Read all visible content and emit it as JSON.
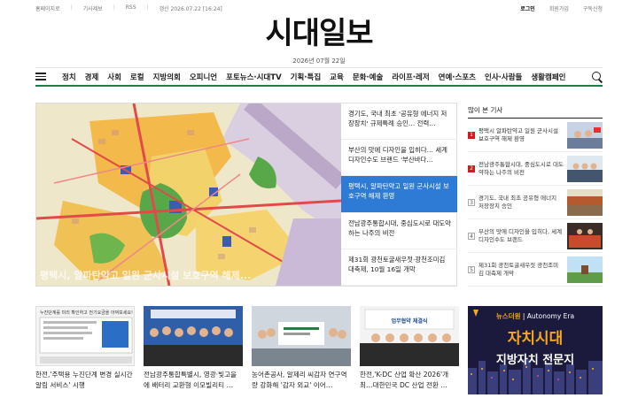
{
  "topbar": {
    "left": [
      "홈페이지로",
      "기사제보",
      "RSS"
    ],
    "updated": "갱신 2026.07.22 [16:24]",
    "right": [
      "로그인",
      "회원가입",
      "구독신청"
    ]
  },
  "masthead": {
    "logo": "시대일보",
    "date": "2026년 07월 22일"
  },
  "nav": {
    "items": [
      "정치",
      "경제",
      "사회",
      "로컬",
      "지방의회",
      "오피니언",
      "포토뉴스·시대TV",
      "기획·특집",
      "교육",
      "문화·예술",
      "라이프·레저",
      "연예·스포츠",
      "인사·사람들",
      "생활캠페인"
    ]
  },
  "hero": {
    "caption": "평택시, 알파탄약고 일원 군사시설 보호구역 해제...",
    "items": [
      "경기도, 국내 최초 '공유형 에너지 저장장치' 규제특례 승인… 전력…",
      "부산의 맛에 디자인을 입히다… 세계디자인수도 브랜드 '부산바다…",
      "평택시, 알파탄약고 일원 군사시설 보호구역 해제 환영",
      "전남광주통합시대, 중심도시로 대도약하는 나주의 비전",
      "제31회 광천토굴새우젓·광천조미김 대축제, 10월 16일 개막"
    ]
  },
  "side": {
    "title": "많이 본 기사",
    "items": [
      {
        "rank": "1",
        "text": "평택시 알파탄약고 일원 군사시설 보호구역 해제 환영"
      },
      {
        "rank": "2",
        "text": "전남광주통합시대, 중심도시로 대도약하는 나주의 비전"
      },
      {
        "rank": "3",
        "text": "경기도, 국내 최초 공유형 에너지 저장장치 승인"
      },
      {
        "rank": "4",
        "text": "부산의 맛에 디자인을 입히다, 세계디자인수도 브랜드"
      },
      {
        "rank": "5",
        "text": "제31회 광천토굴새우젓 광천조미김 대축제 개막"
      }
    ]
  },
  "cards": [
    {
      "title": "한전,'주택용 누진단계 변경 실시간 알림 서비스' 시행",
      "thumb_text": "누진단계를 미리 확인하고 전기요금을 아껴보세요!"
    },
    {
      "title": "전남광주통합특별시, 영광·빛고을에 배터리 교환형 이모빌리티 …",
      "thumb_text": ""
    },
    {
      "title": "농어촌공사, 알제리 씨감자 연구역량 강화해 '감자 외교' 이어…",
      "thumb_text": ""
    },
    {
      "title": "한전,'K-DC 산업 확산 2026'개최…대한민국 DC 산업 전환 …",
      "thumb_text": "업무협약 체결식"
    }
  ],
  "banner": {
    "top_left": "뉴스더원",
    "top_right": "Autonomy Era",
    "main": "자치시대",
    "sub": "지방자치 전문지"
  }
}
